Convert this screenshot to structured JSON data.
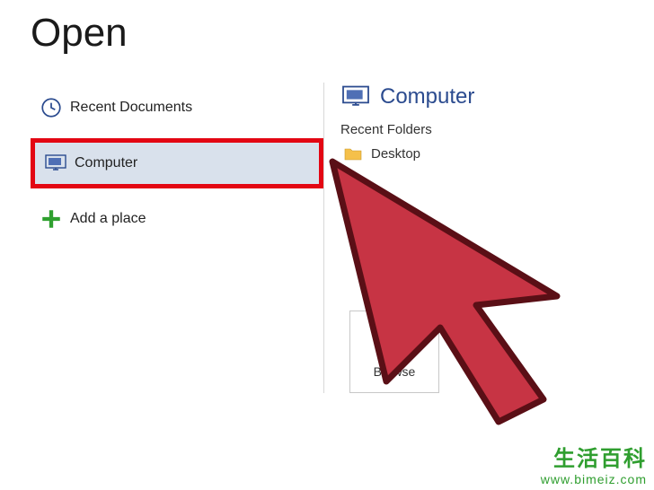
{
  "title": "Open",
  "sidebar": {
    "recent_label": "Recent Documents",
    "computer_label": "Computer",
    "add_place_label": "Add a place"
  },
  "right": {
    "header": "Computer",
    "recent_folders_label": "Recent Folders",
    "folders": [
      {
        "label": "Desktop"
      }
    ],
    "browse_label": "Browse"
  },
  "watermark": {
    "chinese": "生活百科",
    "url": "www.bimeiz.com"
  }
}
